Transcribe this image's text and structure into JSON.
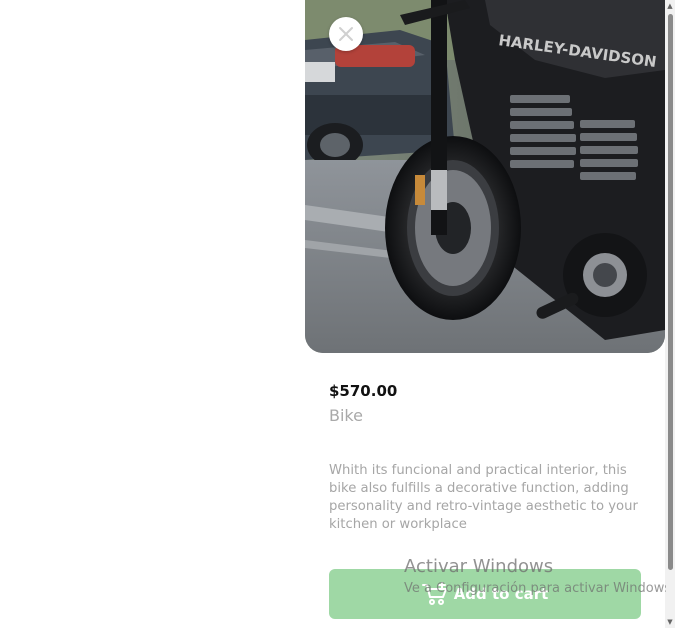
{
  "product": {
    "price": "$570.00",
    "name": "Bike",
    "description": "Whith its funcional and practical interior, this bike also fulfills a decorative function, adding personality and retro-vintage aesthetic to your kitchen or workplace",
    "image_alt": "Harley-Davidson motorcycle",
    "tank_lettering": "HARLEY-DAVIDSON"
  },
  "actions": {
    "close_icon": "close-icon",
    "add_to_cart_label": "Add to cart",
    "cart_icon": "cart-plus-icon"
  },
  "colors": {
    "button": "#9fd8a5",
    "price": "#111111",
    "muted_text": "#a6a6a6"
  },
  "os_watermark": {
    "title": "Activar Windows",
    "subtitle": "Ve a Configuración para activar Windows."
  }
}
